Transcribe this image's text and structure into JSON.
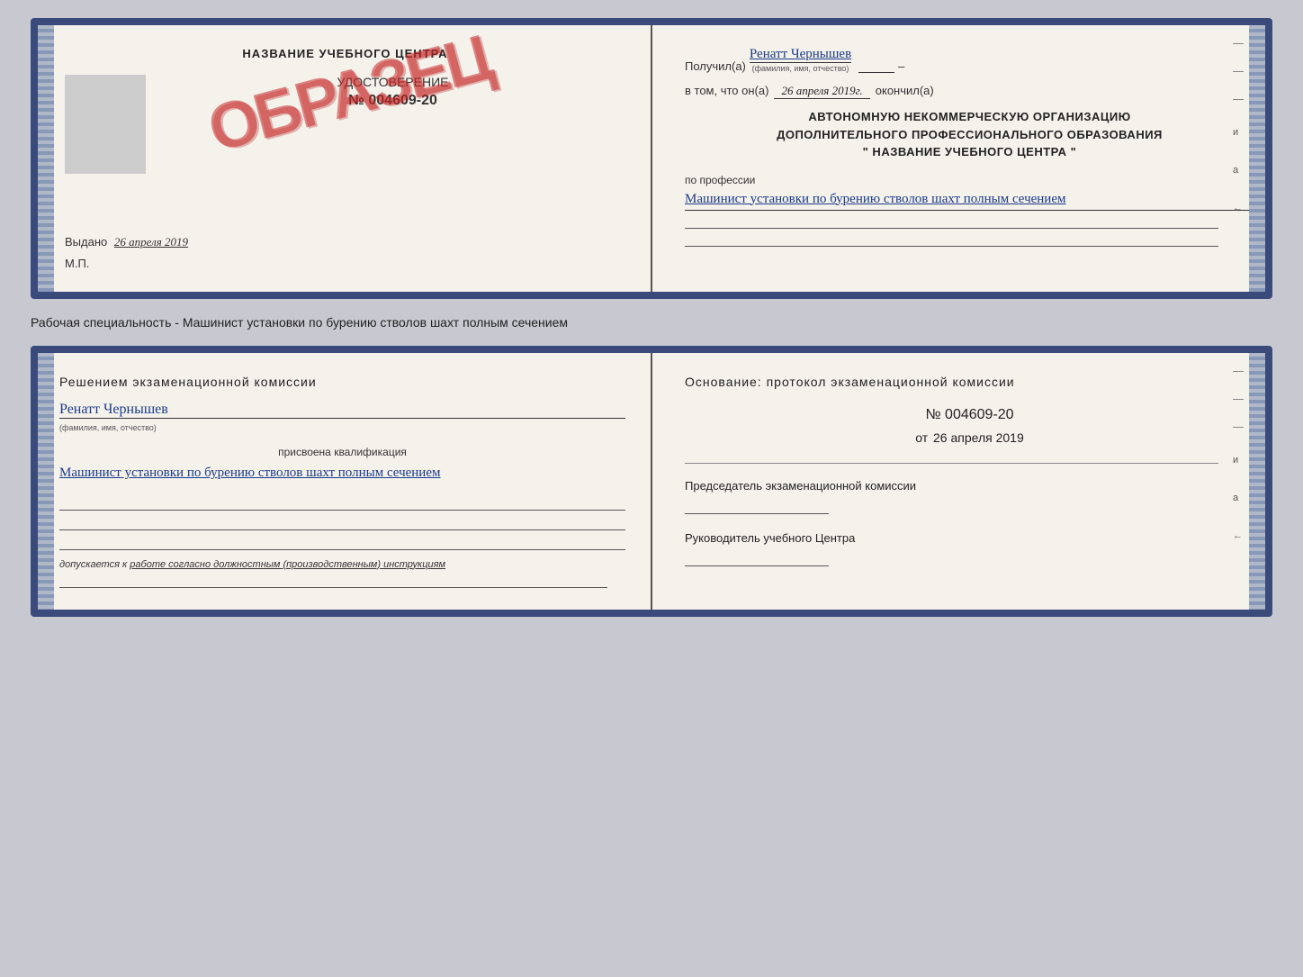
{
  "top": {
    "left": {
      "cert_title": "НАЗВАНИЕ УЧЕБНОГО ЦЕНТРА",
      "cert_subtitle": "УДОСТОВЕРЕНИЕ",
      "cert_number": "№ 004609-20",
      "obraz_stamp": "ОБРАЗЕЦ",
      "issued_label": "Выдано",
      "issued_date": "26 апреля 2019",
      "mp_label": "М.П."
    },
    "right": {
      "received_prefix": "Получил(а)",
      "received_name": "Ренатт Чернышев",
      "received_name_hint": "(фамилия, имя, отчество)",
      "dash": "–",
      "in_that": "в том, что он(а)",
      "date": "26 апреля 2019г.",
      "finished": "окончил(а)",
      "org_line1": "АВТОНОМНУЮ НЕКОММЕРЧЕСКУЮ ОРГАНИЗАЦИЮ",
      "org_line2": "ДОПОЛНИТЕЛЬНОГО ПРОФЕССИОНАЛЬНОГО ОБРАЗОВАНИЯ",
      "org_line3": "\"  НАЗВАНИЕ УЧЕБНОГО ЦЕНТРА  \"",
      "profession_label": "по профессии",
      "profession_value": "Машинист установки по бурению стволов шахт полным сечением"
    }
  },
  "separator": "Рабочая специальность - Машинист установки по бурению стволов шахт полным сечением",
  "bottom": {
    "left": {
      "exam_title": "Решением  экзаменационной  комиссии",
      "person_name": "Ренатт Чернышев",
      "name_hint": "(фамилия, имя, отчество)",
      "qualification_label": "присвоена квалификация",
      "qualification_value": "Машинист установки по бурению стволов шахт полным сечением",
      "admitted_label": "допускается к",
      "admitted_value": "работе согласно должностным (производственным) инструкциям"
    },
    "right": {
      "basis_title": "Основание:  протокол  экзаменационной  комиссии",
      "protocol_number": "№  004609-20",
      "protocol_date_prefix": "от",
      "protocol_date": "26 апреля 2019",
      "chairman_label": "Председатель экзаменационной комиссии",
      "director_label": "Руководитель учебного Центра"
    }
  },
  "side_marks": {
    "mark1": "и",
    "mark2": "а",
    "mark3": "←"
  }
}
